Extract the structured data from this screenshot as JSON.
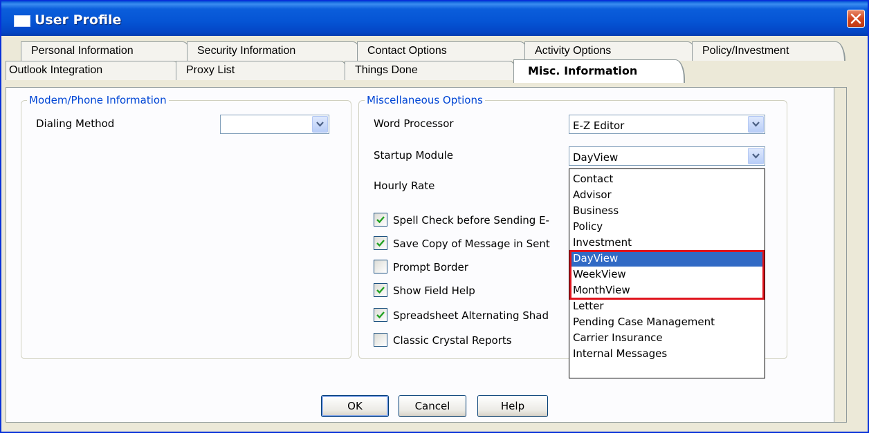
{
  "window": {
    "title": "User Profile"
  },
  "tabs": {
    "row1": [
      "Personal Information",
      "Security Information",
      "Contact Options",
      "Activity Options",
      "Policy/Investment"
    ],
    "row2": [
      "Outlook Integration",
      "Proxy List",
      "Things Done",
      "Misc. Information"
    ],
    "active": "Misc. Information"
  },
  "modem_group": {
    "legend": "Modem/Phone Information",
    "dialing_label": "Dialing Method",
    "dialing_value": ""
  },
  "misc_group": {
    "legend": "Miscellaneous Options",
    "word_processor_label": "Word Processor",
    "word_processor_value": "E-Z Editor",
    "startup_module_label": "Startup Module",
    "startup_module_value": "DayView",
    "hourly_rate_label": "Hourly Rate",
    "checkboxes": [
      {
        "label": "Spell Check before Sending E-mail",
        "visible": "Spell Check before Sending E-",
        "checked": true
      },
      {
        "label": "Save Copy of Message in Sent",
        "visible": "Save Copy of Message in Sent",
        "checked": true
      },
      {
        "label": "Prompt Border",
        "visible": "Prompt Border",
        "checked": false
      },
      {
        "label": "Show Field Help",
        "visible": "Show Field Help",
        "checked": true
      },
      {
        "label": "Spreadsheet Alternating Shading",
        "visible": "Spreadsheet Alternating Shad",
        "checked": true
      },
      {
        "label": "Classic Crystal Reports",
        "visible": "Classic Crystal Reports",
        "checked": false
      }
    ]
  },
  "startup_dropdown": {
    "options": [
      "Contact",
      "Advisor",
      "Business",
      "Policy",
      "Investment",
      "DayView",
      "WeekView",
      "MonthView",
      "Letter",
      "Pending Case Management",
      "Carrier Insurance",
      "Internal Messages"
    ],
    "selected": "DayView"
  },
  "buttons": {
    "ok": "OK",
    "cancel": "Cancel",
    "help": "Help"
  },
  "colors": {
    "title_bar": "#0554d4",
    "legend_text": "#0046d5",
    "selection": "#316ac5",
    "highlight_box": "#e0141d"
  }
}
